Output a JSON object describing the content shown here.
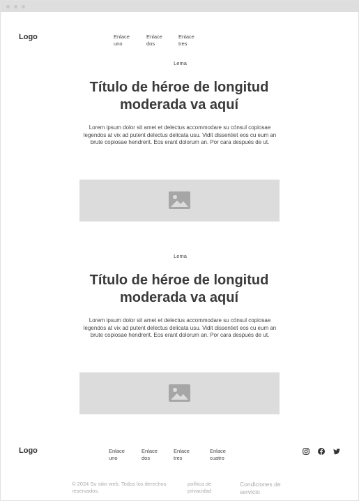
{
  "header": {
    "logo": "Logo",
    "nav": [
      {
        "line1": "Enlace",
        "line2": "uno"
      },
      {
        "line1": "Enlace",
        "line2": "dos"
      },
      {
        "line1": "Enlace",
        "line2": "tres"
      }
    ]
  },
  "sections": [
    {
      "tagline": "Lema",
      "title_line1": "Título de héroe de longitud",
      "title_line2": "moderada va aquí",
      "body": "Lorem ipsum dolor sit amet et delectus accommodare su cónsul copiosae legendos at vix ad putent delectus delicata usu. Vidit dissentiet eos cu eum an brute copiosae hendrerit. Eos erant dolorum an. Por cara después de ut.",
      "image_icon": "image-icon"
    },
    {
      "tagline": "Lema",
      "title_line1": "Título de héroe de longitud",
      "title_line2": "moderada va aquí",
      "body": "Lorem ipsum dolor sit amet et delectus accommodare su cónsul copiosae legendos at vix ad putent delectus delicata usu. Vidit dissentiet eos cu eum an brute copiosae hendrerit. Eos erant dolorum an. Por cara después de ut.",
      "image_icon": "image-icon"
    }
  ],
  "footer": {
    "logo": "Logo",
    "nav": [
      {
        "line1": "Enlace",
        "line2": "uno"
      },
      {
        "line1": "Enlace",
        "line2": "dos"
      },
      {
        "line1": "Enlace",
        "line2": "tres"
      },
      {
        "line1": "Enlace",
        "line2": "cuatro"
      }
    ],
    "social_icons": [
      "instagram-icon",
      "facebook-icon",
      "twitter-icon"
    ],
    "copyright_line1": "© 2024 Su sitio web. Todos los derechos",
    "copyright_line2": "reservados.",
    "privacy_line1": "política de",
    "privacy_line2": "privacidad",
    "terms_line1": "Condiciones de",
    "terms_line2": "servicio"
  },
  "colors": {
    "text": "#3a3a3a",
    "placeholder": "#dcdcdc",
    "chrome": "#dedede",
    "muted": "#aaaaaa"
  }
}
